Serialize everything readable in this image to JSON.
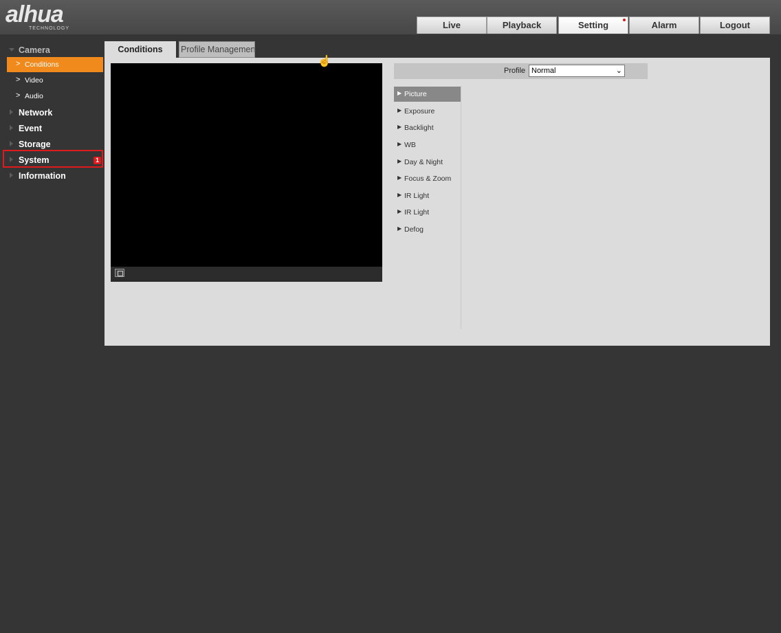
{
  "logo": {
    "text": "alhua",
    "subtitle": "TECHNOLOGY"
  },
  "top_nav": {
    "live": "Live",
    "playback": "Playback",
    "setting": "Setting",
    "alarm": "Alarm",
    "logout": "Logout"
  },
  "sidebar": {
    "camera": "Camera",
    "conditions": "Conditions",
    "video": "Video",
    "audio": "Audio",
    "network": "Network",
    "event": "Event",
    "storage": "Storage",
    "system": "System",
    "system_badge": "1",
    "information": "Information"
  },
  "tabs": {
    "conditions": "Conditions",
    "profile_management": "Profile Management"
  },
  "profile": {
    "label": "Profile",
    "value": "Normal"
  },
  "conditions_menu": [
    {
      "label": "Picture"
    },
    {
      "label": "Exposure"
    },
    {
      "label": "Backlight"
    },
    {
      "label": "WB"
    },
    {
      "label": "Day & Night"
    },
    {
      "label": "Focus & Zoom"
    },
    {
      "label": "IR Light"
    },
    {
      "label": "IR Light"
    },
    {
      "label": "Defog"
    }
  ],
  "colors": {
    "active_orange": "#f08a1c",
    "highlight_red": "#e0191c"
  }
}
